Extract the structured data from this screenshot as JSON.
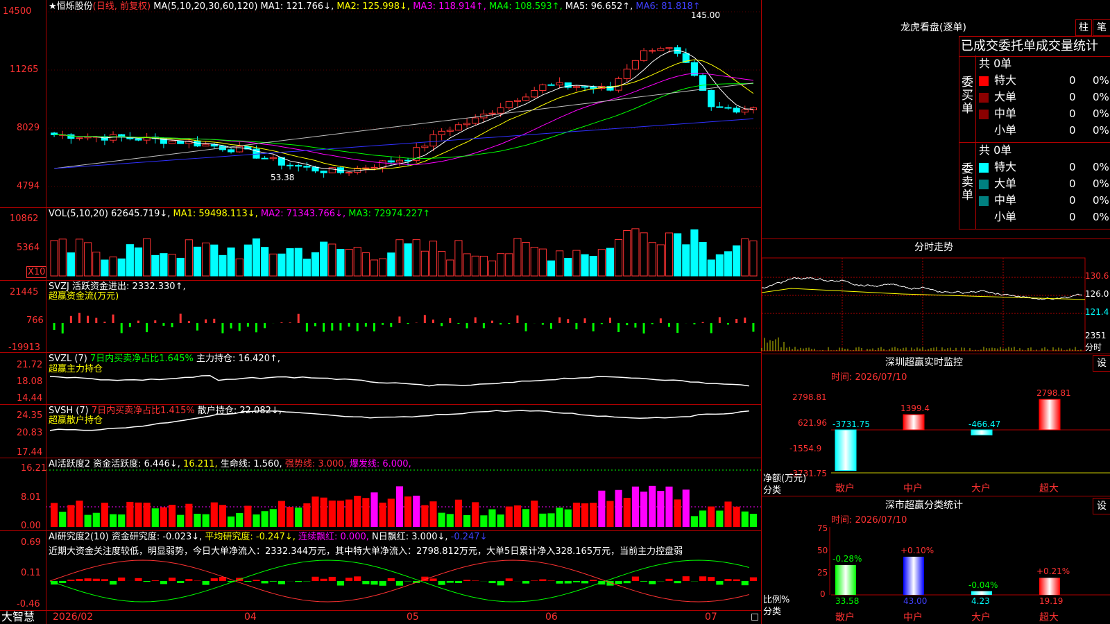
{
  "stock": {
    "star": "★",
    "name": "恒烁股份",
    "mode": "(日线, 前复权)"
  },
  "ma_header": {
    "ma_label": "MA(5,10,20,30,60,120)",
    "ma1": "MA1: 121.766↓,",
    "ma2": "MA2: 125.998↓,",
    "ma3": "MA3: 118.914↑,",
    "ma4": "MA4: 108.593↑,",
    "ma5": "MA5: 96.652↑,",
    "ma6": "MA6: 81.818↑"
  },
  "price_axis": [
    "14500",
    "11265",
    "8029",
    "4794"
  ],
  "price_annotations": {
    "high": "145.00",
    "low": "53.38"
  },
  "vol_header": {
    "label": "VOL(5,10,20)",
    "value": "62645.719↓,",
    "ma1": "MA1: 59498.113↓,",
    "ma2": "MA2: 71343.766↓,",
    "ma3": "MA3: 72974.227↑"
  },
  "vol_axis": [
    "10862",
    "5364"
  ],
  "vol_unit": "X10",
  "svzj": {
    "label": "SVZJ",
    "desc": "活跃资金进出: 2332.330↑,",
    "sub": "超赢资金流(万元)",
    "axis": [
      "21445",
      "766",
      "-19913"
    ]
  },
  "svzl": {
    "label": "SVZL (7)",
    "desc1": "7日内买卖净占比1.645%",
    "desc2": "主力持仓: 16.420↑,",
    "sub": "超赢主力持仓",
    "axis": [
      "21.72",
      "18.08",
      "14.44"
    ]
  },
  "svsh": {
    "label": "SVSH (7)",
    "desc1": "7日内买卖净占比1.415%",
    "desc2": "散户持仓: 22.082↓,",
    "sub": "超赢散户持仓",
    "axis": [
      "24.35",
      "20.83",
      "17.44"
    ]
  },
  "ai1": {
    "label": "AI活跃度2",
    "d1": "资金活跃度: 6.446↓,",
    "d2": "16.211,",
    "d3": "生命线: 1.560,",
    "d4": "强势线: 3.000,",
    "d5": "爆发线: 6.000,",
    "axis": [
      "16.21",
      "8.01",
      "0.00"
    ]
  },
  "ai2": {
    "label": "AI研究度2(10)",
    "d1": "资金研究度: -0.023↓,",
    "d2": "平均研究度: -0.247↓,",
    "d3": "连续飘红: 0.000,",
    "d4": "N日飘红: 3.000↓,",
    "d5": "-0.247↓",
    "note": "近期大资金关注度较低，明显弱势，今日大单净流入：2332.344万元，其中特大单净流入：2798.812万元，大单5日累计净入328.165万元，当前主力控盘弱",
    "axis": [
      "0.69",
      "0.11",
      "-0.46"
    ]
  },
  "date_axis": [
    "2026/02",
    "04",
    "05",
    "06",
    "07"
  ],
  "brand": "大智慧",
  "lhb": {
    "title": "龙虎看盘(逐单)",
    "btn1": "柱",
    "btn2": "笔",
    "tabs": "已成交委托单成交量统计",
    "buy_total": "共 0单",
    "sell_total": "共 0单",
    "buy_label": "委买单",
    "sell_label": "委卖单",
    "rows": [
      {
        "name": "特大",
        "v": "0",
        "p": "0%"
      },
      {
        "name": "大单",
        "v": "0",
        "p": "0%"
      },
      {
        "name": "中单",
        "v": "0",
        "p": "0%"
      },
      {
        "name": "小单",
        "v": "0",
        "p": "0%"
      }
    ]
  },
  "fenshi": {
    "title": "分时走势",
    "axis": [
      "130.6",
      "126.0",
      "121.4",
      "2351"
    ],
    "unit": "分时"
  },
  "sz_monitor": {
    "title": "深圳超赢实时监控",
    "btn": "设",
    "time": "时间: 2026/07/10",
    "axis": [
      "2798.81",
      "621.96",
      "-1554.9",
      "-3731.75"
    ],
    "bars": [
      {
        "cat": "散户",
        "val": "-3731.75",
        "num": -3731.75
      },
      {
        "cat": "中户",
        "val": "1399.4",
        "num": 1399.4
      },
      {
        "cat": "大户",
        "val": "-466.47",
        "num": -466.47
      },
      {
        "cat": "超大",
        "val": "2798.81",
        "num": 2798.81
      }
    ],
    "ylabel": "净额(万元)",
    "xlabel": "分类"
  },
  "sz_stat": {
    "title": "深市超赢分类统计",
    "btn": "设",
    "time": "时间: 2026/07/10",
    "axis": [
      "75",
      "50",
      "25",
      "0"
    ],
    "bars": [
      {
        "cat": "散户",
        "val": "33.58",
        "chg": "-0.28%",
        "num": 33.58
      },
      {
        "cat": "中户",
        "val": "43.00",
        "chg": "+0.10%",
        "num": 43.0
      },
      {
        "cat": "大户",
        "val": "4.23",
        "chg": "-0.04%",
        "num": 4.23
      },
      {
        "cat": "超大",
        "val": "19.19",
        "chg": "+0.21%",
        "num": 19.19
      }
    ],
    "ylabel": "比例%",
    "xlabel": "分类"
  },
  "colors": {
    "up": "#ff3232",
    "down": "#00ffff",
    "grid": "#b00000"
  }
}
